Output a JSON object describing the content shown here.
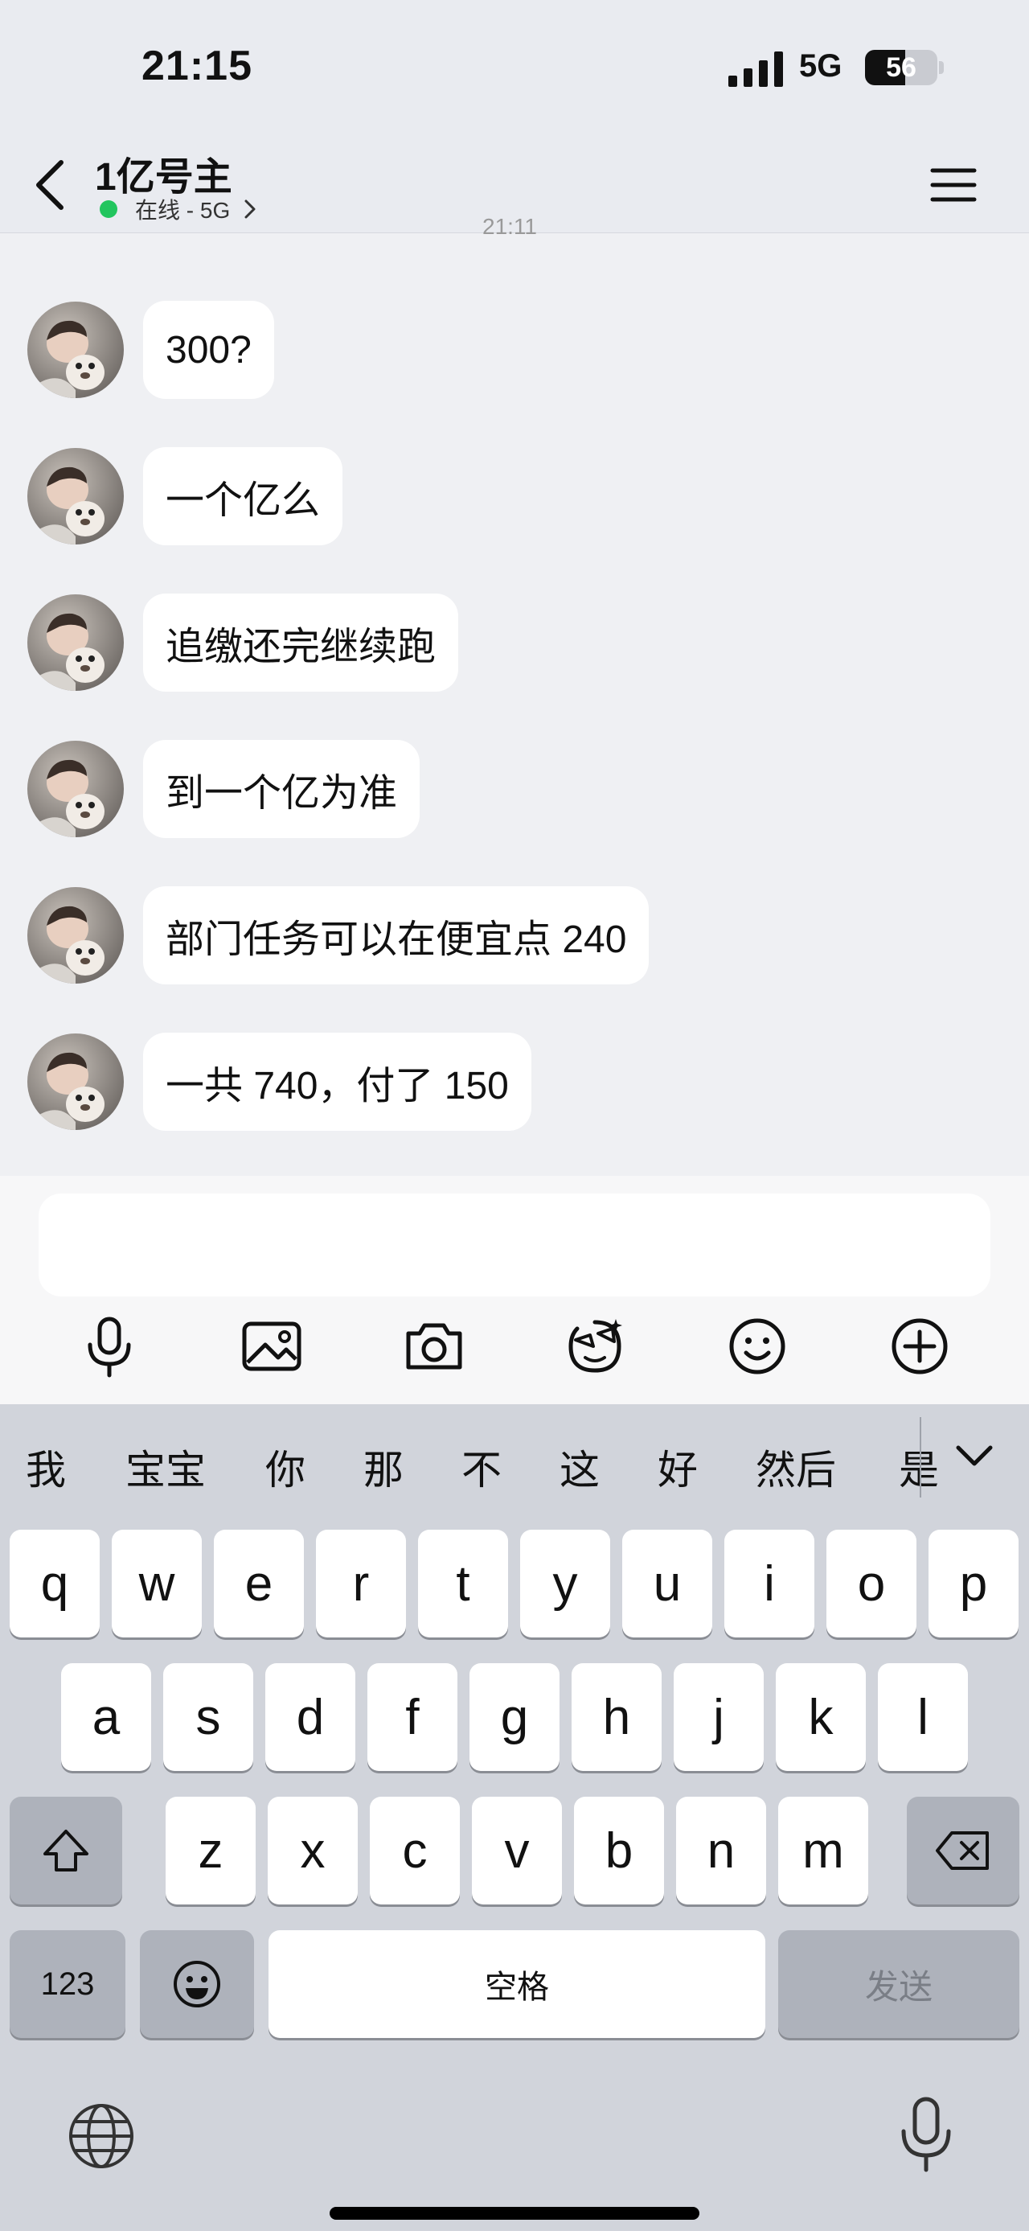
{
  "status_bar": {
    "time": "21:15",
    "network": "5G",
    "battery_percent": 56,
    "battery_label": "56"
  },
  "header": {
    "title": "1亿号主",
    "status_text": "在线 - 5G",
    "status_color": "#22c55e"
  },
  "timestamp_partial": "21:11",
  "messages": [
    {
      "text": "300?"
    },
    {
      "text": "一个亿么"
    },
    {
      "text": "追缴还完继续跑"
    },
    {
      "text": "到一个亿为准"
    },
    {
      "text": "部门任务可以在便宜点 240"
    },
    {
      "text": "一共 740，付了 150"
    }
  ],
  "input": {
    "value": "",
    "placeholder": ""
  },
  "toolbar_icons": [
    "mic-icon",
    "image-icon",
    "camera-icon",
    "sticker-icon",
    "emoji-icon",
    "add-icon"
  ],
  "keyboard": {
    "candidates": [
      "我",
      "宝宝",
      "你",
      "那",
      "不",
      "这",
      "好",
      "然后",
      "是"
    ],
    "row1": [
      "q",
      "w",
      "e",
      "r",
      "t",
      "y",
      "u",
      "i",
      "o",
      "p"
    ],
    "row2": [
      "a",
      "s",
      "d",
      "f",
      "g",
      "h",
      "j",
      "k",
      "l"
    ],
    "row3": [
      "z",
      "x",
      "c",
      "v",
      "b",
      "n",
      "m"
    ],
    "numbers_key": "123",
    "space_key": "空格",
    "send_key": "发送"
  }
}
